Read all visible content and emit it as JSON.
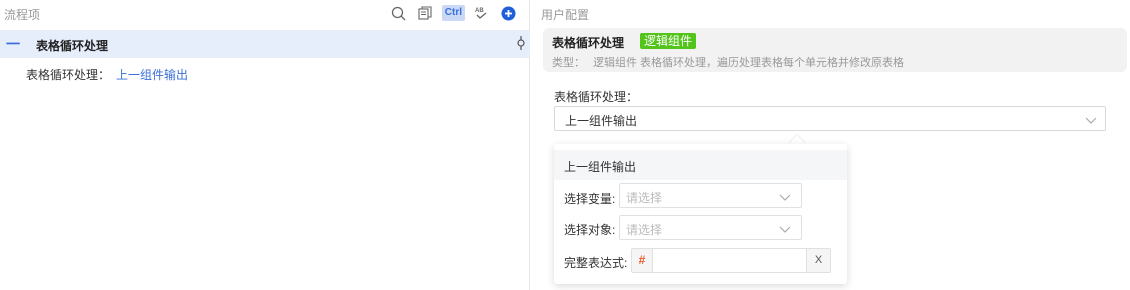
{
  "left_panel": {
    "title": "流程项",
    "toolbar": {
      "ctrl_label": "Ctrl",
      "icons": [
        "search-icon",
        "copy-icon",
        "ctrl-badge",
        "spellcheck-icon",
        "add-circle-icon"
      ]
    },
    "selected_node": {
      "collapse_symbol": "一",
      "name": "表格循环处理"
    },
    "property_row": {
      "label": "表格循环处理：",
      "value": "上一组件输出"
    }
  },
  "right_panel": {
    "title": "用户配置",
    "info_card": {
      "name": "表格循环处理",
      "tag": "逻辑组件",
      "type_label": "类型：",
      "type_value": "逻辑组件 表格循环处理，遍历处理表格每个单元格并修改原表格"
    },
    "field": {
      "label": "表格循环处理：",
      "selected_value": "上一组件输出"
    },
    "dropdown": {
      "header": "上一组件输出",
      "variable_label": "选择变量:",
      "variable_placeholder": "请选择",
      "object_label": "选择对象:",
      "object_placeholder": "请选择",
      "expression_label": "完整表达式:",
      "expression_prefix": "#",
      "expression_value": "",
      "clear_label": "X"
    }
  },
  "colors": {
    "accent": "#3a6fd8",
    "tag_green": "#52c41a",
    "selected_bg": "#e6edfb",
    "hash_orange": "#e85a2a"
  }
}
